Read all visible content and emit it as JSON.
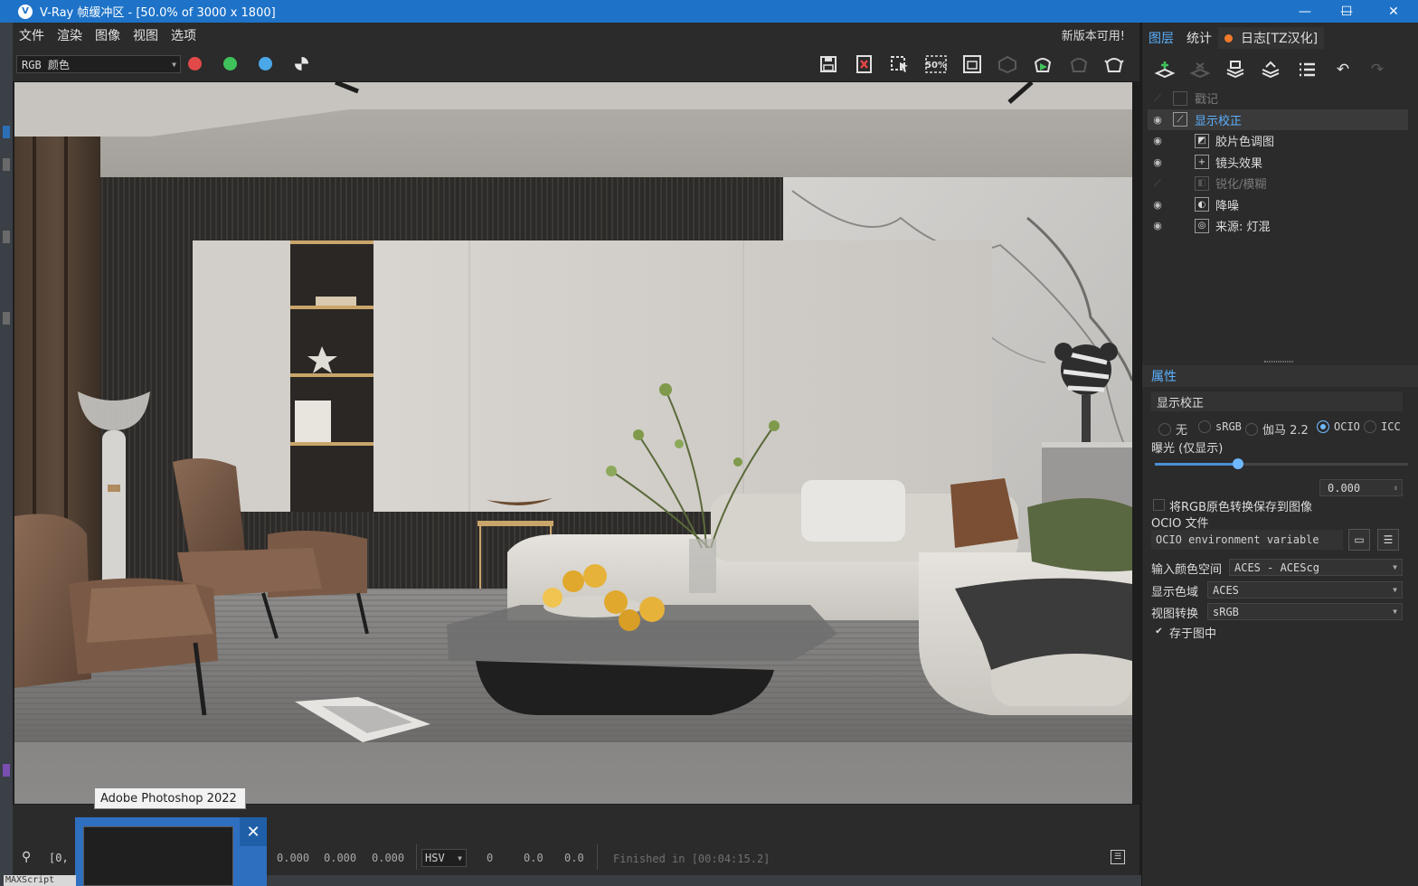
{
  "window": {
    "title": "V-Ray 帧缓冲区 - [50.0% of 3000 x 1800]",
    "logo": "V",
    "minimize": "—",
    "maximize": "☐",
    "close": "✕"
  },
  "menu": {
    "items": [
      "文件",
      "渲染",
      "图像",
      "视图",
      "选项"
    ],
    "update_notice": "新版本可用!"
  },
  "toolbar": {
    "channel": "RGB 颜色",
    "channel_dots": {
      "red": "#e24a4a",
      "green": "#3fc25c",
      "blue": "#4aa8e8",
      "mono": "#e8e8e8"
    },
    "icons": [
      "save-image-icon",
      "clear-image-icon",
      "region-select-icon",
      "zoom-50-icon",
      "region-render-icon",
      "track-mouse-icon",
      "render-icon",
      "render-interactive-icon",
      "teapot-render-icon"
    ],
    "zoom_label": "50%"
  },
  "status": {
    "coord": "[0,",
    "rgb": [
      "0.000",
      "0.000",
      "0.000"
    ],
    "color_mode": "HSV",
    "hsv": [
      "0",
      "0.0",
      "0.0"
    ],
    "finished": "Finished in [00:04:15.2]"
  },
  "taskbar": {
    "tooltip": "Adobe Photoshop 2022",
    "maxscript": "MAXScript"
  },
  "panel": {
    "tabs": {
      "layers": "图层",
      "stats": "统计",
      "log": "日志[TZ汉化]"
    },
    "log_dot_color": "#f07a2a",
    "layers": [
      {
        "label": "戳记",
        "visible": false,
        "indent": 0,
        "icon": ""
      },
      {
        "label": "显示校正",
        "visible": true,
        "indent": 0,
        "icon": "⟋",
        "selected": true
      },
      {
        "label": "胶片色调图",
        "visible": true,
        "indent": 1,
        "icon": "◩"
      },
      {
        "label": "镜头效果",
        "visible": true,
        "indent": 1,
        "icon": "+"
      },
      {
        "label": "锐化/模糊",
        "visible": false,
        "indent": 1,
        "icon": "◧"
      },
      {
        "label": "降噪",
        "visible": true,
        "indent": 1,
        "icon": "◐"
      },
      {
        "label": "来源: 灯混",
        "visible": true,
        "indent": 1,
        "icon": "◎"
      }
    ],
    "properties": {
      "header": "属性",
      "name": "显示校正",
      "modes": [
        "无",
        "sRGB",
        "伽马 2.2",
        "OCIO",
        "ICC"
      ],
      "selected_mode": "OCIO",
      "exposure_label": "曝光 (仅显示)",
      "exposure_value": "0.000",
      "exposure_fraction": 0.33,
      "save_rgb_label": "将RGB原色转换保存到图像",
      "ocio_file_label": "OCIO 文件",
      "ocio_file_value": "OCIO environment variable",
      "input_colorspace_label": "输入颜色空间",
      "input_colorspace_value": "ACES - ACEScg",
      "display_label": "显示色域",
      "display_value": "ACES",
      "view_label": "视图转换",
      "view_value": "sRGB",
      "store_label": "存于图中",
      "store_checked": true
    }
  }
}
